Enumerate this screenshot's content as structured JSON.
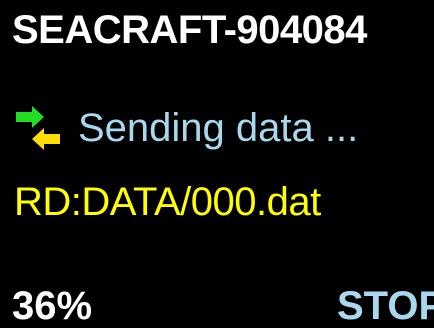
{
  "device": {
    "title": "SEACRAFT-904084"
  },
  "status": {
    "icon": "transfer-arrows-icon",
    "text": "Sending data ...",
    "color": "#a9d8ee"
  },
  "file": {
    "line": "RD:DATA/000.dat",
    "color": "#ffff00"
  },
  "progress": {
    "label": "36%",
    "value": 36
  },
  "actions": {
    "stop_label": "STOP",
    "color": "#a9d8ee"
  },
  "icon_colors": {
    "outgoing": "#22dd22",
    "incoming": "#ffdd00"
  }
}
